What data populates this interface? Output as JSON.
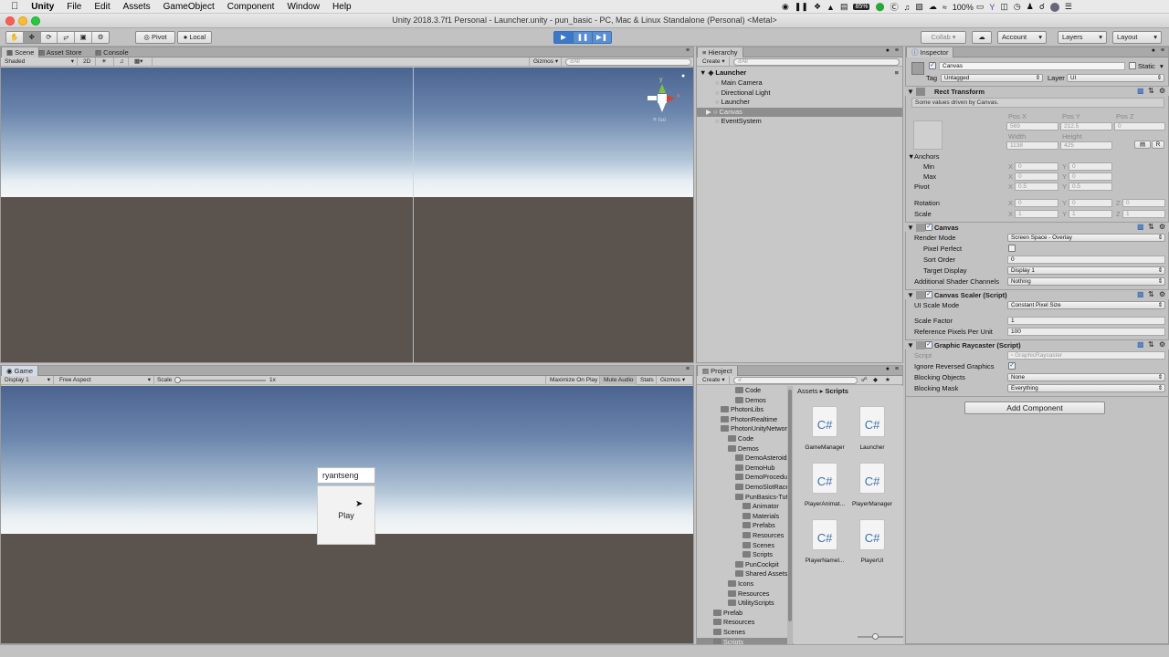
{
  "menubar": {
    "apple": "",
    "items": [
      "Unity",
      "File",
      "Edit",
      "Assets",
      "GameObject",
      "Component",
      "Window",
      "Help"
    ],
    "battery": "100%",
    "icon_badge": "85%"
  },
  "window": {
    "title": "Unity 2018.3.7f1 Personal - Launcher.unity - pun_basic - PC, Mac & Linux Standalone (Personal) <Metal>"
  },
  "toolbar": {
    "pivot": "Pivot",
    "local": "Local",
    "collab": "Collab ▾",
    "account": "Account",
    "layers": "Layers",
    "layout": "Layout"
  },
  "scene": {
    "tabs": [
      "Scene",
      "Asset Store",
      "Console"
    ],
    "shading": "Shaded",
    "mode2d": "2D",
    "gizmos": "Gizmos",
    "search_placeholder": "All",
    "iso": "≡ Iso",
    "axis_y": "y",
    "axis_x": "x",
    "axis_z": "z"
  },
  "game": {
    "tab": "Game",
    "display": "Display 1",
    "aspect": "Free Aspect",
    "scale_label": "Scale",
    "scale_value": "1x",
    "maximize": "Maximize On Play",
    "mute": "Mute Audio",
    "stats": "Stats",
    "gizmos": "Gizmos",
    "input_value": "ryantseng",
    "play_label": "Play"
  },
  "hierarchy": {
    "tab": "Hierarchy",
    "create": "Create",
    "search_placeholder": "All",
    "scene": "Launcher",
    "items": [
      "Main Camera",
      "Directional Light",
      "Launcher",
      "Canvas",
      "EventSystem"
    ]
  },
  "project": {
    "tab": "Project",
    "create": "Create",
    "breadcrumb_root": "Assets",
    "breadcrumb_current": "Scripts",
    "tree": [
      {
        "label": "Code",
        "indent": 3,
        "arrow": ""
      },
      {
        "label": "Demos",
        "indent": 3,
        "arrow": "▶"
      },
      {
        "label": "PhotonLibs",
        "indent": 1,
        "arrow": "▶"
      },
      {
        "label": "PhotonRealtime",
        "indent": 1,
        "arrow": "▶"
      },
      {
        "label": "PhotonUnityNetworking",
        "indent": 1,
        "arrow": "▼"
      },
      {
        "label": "Code",
        "indent": 2,
        "arrow": "▶"
      },
      {
        "label": "Demos",
        "indent": 2,
        "arrow": "▼"
      },
      {
        "label": "DemoAsteroids",
        "indent": 3,
        "arrow": "▶"
      },
      {
        "label": "DemoHub",
        "indent": 3,
        "arrow": "▶"
      },
      {
        "label": "DemoProcedural",
        "indent": 3,
        "arrow": "▶"
      },
      {
        "label": "DemoSlotRacer",
        "indent": 3,
        "arrow": "▶"
      },
      {
        "label": "PunBasics-Tutorial",
        "indent": 3,
        "arrow": "▼"
      },
      {
        "label": "Animator",
        "indent": 4,
        "arrow": ""
      },
      {
        "label": "Materials",
        "indent": 4,
        "arrow": ""
      },
      {
        "label": "Prefabs",
        "indent": 4,
        "arrow": ""
      },
      {
        "label": "Resources",
        "indent": 4,
        "arrow": ""
      },
      {
        "label": "Scenes",
        "indent": 4,
        "arrow": ""
      },
      {
        "label": "Scripts",
        "indent": 4,
        "arrow": ""
      },
      {
        "label": "PunCockpit",
        "indent": 3,
        "arrow": "▶"
      },
      {
        "label": "Shared Assets",
        "indent": 3,
        "arrow": "▶"
      },
      {
        "label": "Icons",
        "indent": 2,
        "arrow": ""
      },
      {
        "label": "Resources",
        "indent": 2,
        "arrow": ""
      },
      {
        "label": "UtilityScripts",
        "indent": 2,
        "arrow": "▶"
      },
      {
        "label": "Prefab",
        "indent": 0,
        "arrow": ""
      },
      {
        "label": "Resources",
        "indent": 0,
        "arrow": ""
      },
      {
        "label": "Scenes",
        "indent": 0,
        "arrow": ""
      },
      {
        "label": "Scripts",
        "indent": 0,
        "arrow": ""
      }
    ],
    "files": [
      "GameManager",
      "Launcher",
      "PlayerAnimat...",
      "PlayerManager",
      "PlayerNamel...",
      "PlayerUI"
    ],
    "file_glyph": "C#"
  },
  "inspector": {
    "tab": "Inspector",
    "object_name": "Canvas",
    "static_label": "Static",
    "tag_label": "Tag",
    "tag_value": "Untagged",
    "layer_label": "Layer",
    "layer_value": "UI",
    "rect": {
      "title": "Rect Transform",
      "note": "Some values driven by Canvas.",
      "pos_x_label": "Pos X",
      "pos_y_label": "Pos Y",
      "pos_z_label": "Pos Z",
      "pos_x": "569",
      "pos_y": "212.5",
      "pos_z": "0",
      "width_label": "Width",
      "height_label": "Height",
      "width": "1138",
      "height": "425",
      "anchors": "Anchors",
      "min": "Min",
      "max": "Max",
      "min_x": "0",
      "min_y": "0",
      "max_x": "0",
      "max_y": "0",
      "pivot": "Pivot",
      "pivot_x": "0.5",
      "pivot_y": "0.5",
      "rotation": "Rotation",
      "rot_x": "0",
      "rot_y": "0",
      "rot_z": "0",
      "scale": "Scale",
      "scale_x": "1",
      "scale_y": "1",
      "scale_z": "1",
      "x": "X",
      "y": "Y",
      "z": "Z",
      "r_btn": "R"
    },
    "canvas": {
      "title": "Canvas",
      "render_mode_label": "Render Mode",
      "render_mode": "Screen Space - Overlay",
      "pixel_perfect": "Pixel Perfect",
      "sort_order_label": "Sort Order",
      "sort_order": "0",
      "target_display_label": "Target Display",
      "target_display": "Display 1",
      "shader_channels_label": "Additional Shader Channels",
      "shader_channels": "Nothing"
    },
    "scaler": {
      "title": "Canvas Scaler (Script)",
      "ui_scale_mode_label": "UI Scale Mode",
      "ui_scale_mode": "Constant Pixel Size",
      "scale_factor_label": "Scale Factor",
      "scale_factor": "1",
      "ref_ppu_label": "Reference Pixels Per Unit",
      "ref_ppu": "100"
    },
    "raycaster": {
      "title": "Graphic Raycaster (Script)",
      "script_label": "Script",
      "script_value": "GraphicRaycaster",
      "ignore_reversed": "Ignore Reversed Graphics",
      "blocking_objects_label": "Blocking Objects",
      "blocking_objects": "None",
      "blocking_mask_label": "Blocking Mask",
      "blocking_mask": "Everything"
    },
    "add_component": "Add Component"
  }
}
